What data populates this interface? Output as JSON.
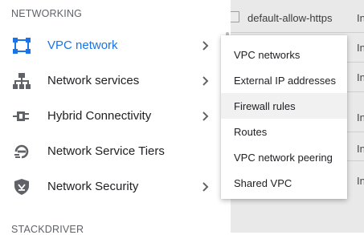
{
  "background_table": {
    "rows": [
      {
        "name": "default-allow-https",
        "col": "In"
      },
      {
        "name": "",
        "col": "In"
      },
      {
        "name": "",
        "col": "In"
      },
      {
        "name": "",
        "col": "In"
      },
      {
        "name": "",
        "col": "In"
      },
      {
        "name": "",
        "col": "In"
      }
    ]
  },
  "nav": {
    "section_networking": "NETWORKING",
    "section_stackdriver": "STACKDRIVER",
    "items": [
      {
        "label": "VPC network",
        "icon": "vpc-network-icon",
        "has_submenu": true,
        "active": true
      },
      {
        "label": "Network services",
        "icon": "network-services-icon",
        "has_submenu": true
      },
      {
        "label": "Hybrid Connectivity",
        "icon": "hybrid-connectivity-icon",
        "has_submenu": true
      },
      {
        "label": "Network Service Tiers",
        "icon": "network-service-tiers-icon",
        "has_submenu": false
      },
      {
        "label": "Network Security",
        "icon": "network-security-icon",
        "has_submenu": true
      }
    ]
  },
  "submenu": {
    "items": [
      {
        "label": "VPC networks"
      },
      {
        "label": "External IP addresses"
      },
      {
        "label": "Firewall rules",
        "hovered": true
      },
      {
        "label": "Routes"
      },
      {
        "label": "VPC network peering"
      },
      {
        "label": "Shared VPC"
      }
    ]
  },
  "colors": {
    "active_blue": "#1a73e8",
    "icon_gray": "#5f6368",
    "hover_bg": "#f1f1f1"
  }
}
